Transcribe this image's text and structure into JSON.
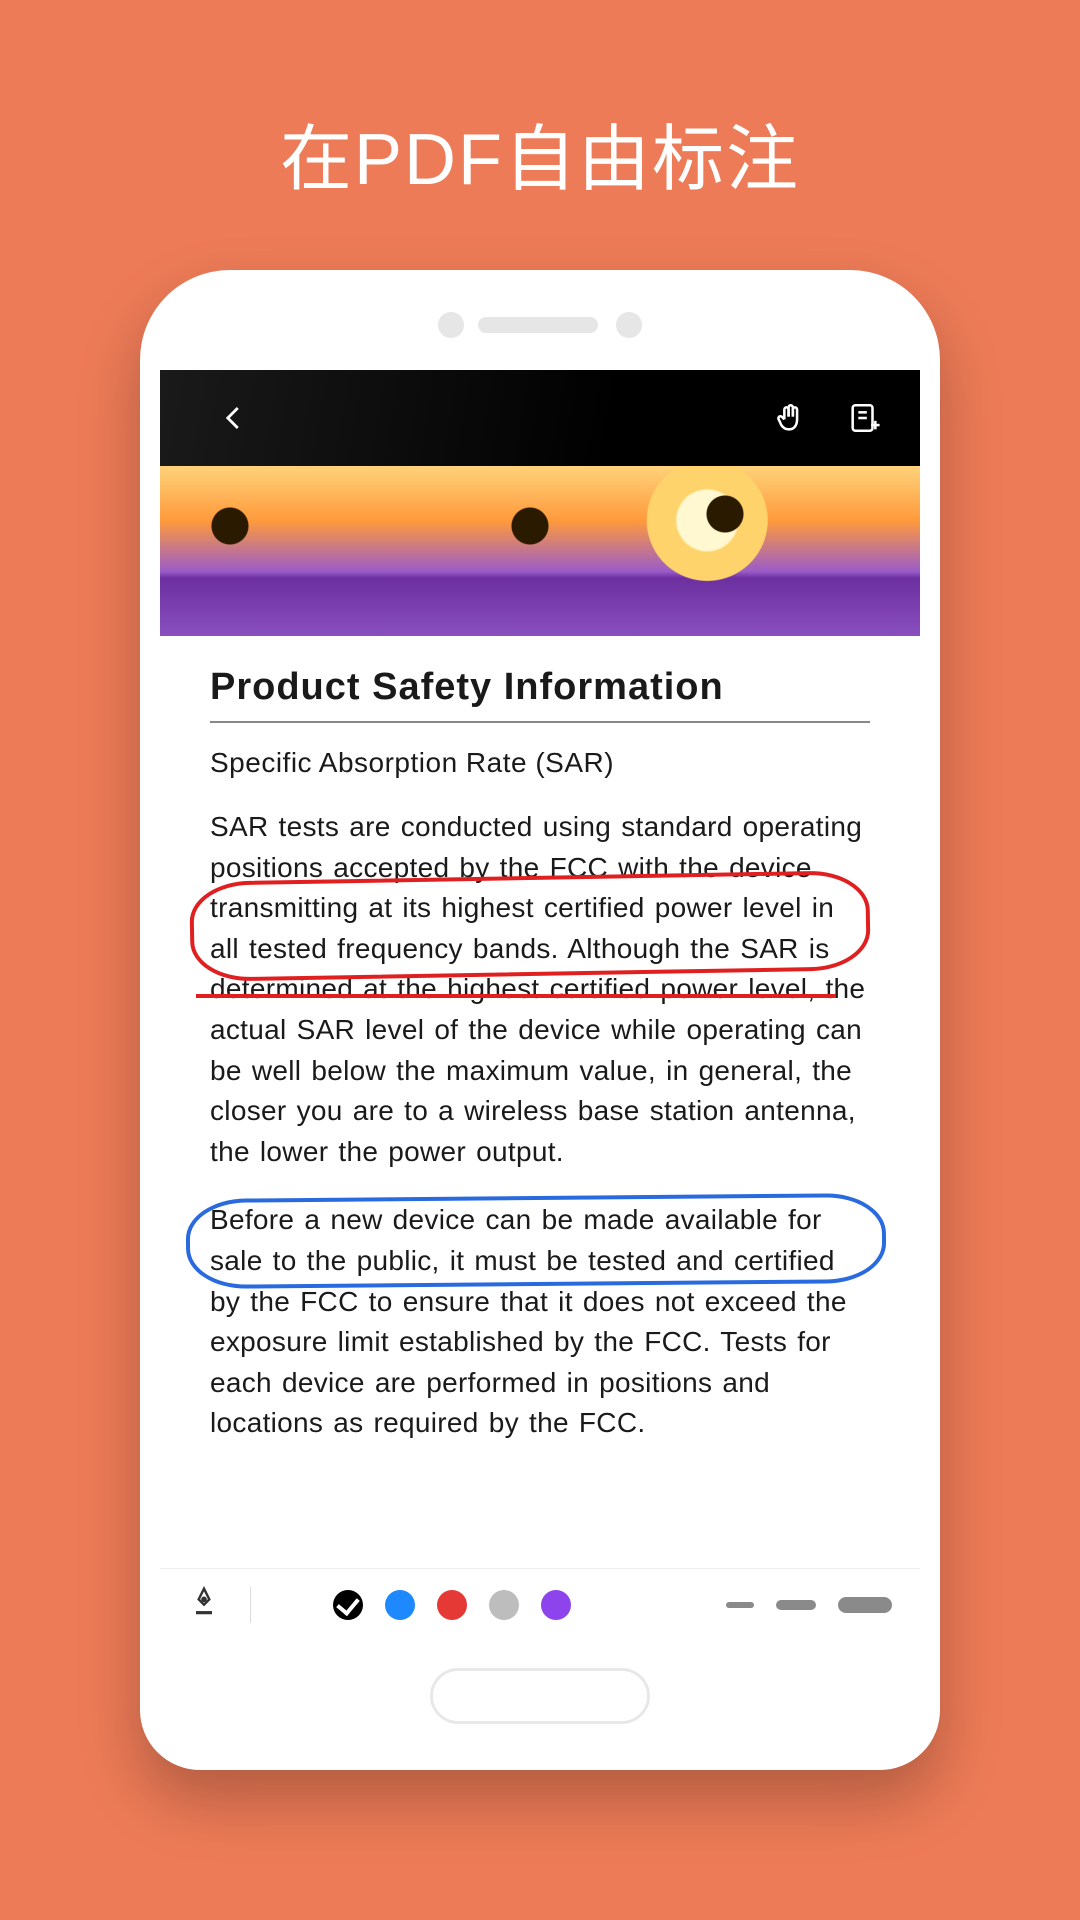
{
  "hero": {
    "title": "在PDF自由标注"
  },
  "topbar": {
    "back_icon": "back-icon",
    "hand_icon": "hand-tool-icon",
    "note_icon": "add-note-icon"
  },
  "document": {
    "title": "Product Safety Information",
    "subtitle": "Specific Absorption Rate (SAR)",
    "para1": "SAR tests are conducted using standard operating positions accepted by the FCC with the device transmitting at its highest certified power level in all tested frequency bands. Although the SAR is determined at the highest certified power level, the actual SAR level of the device while operating can be well below the maximum value, in general, the closer you are to a wireless base station antenna, the lower the power output.",
    "para2": "Before a new device can be made available for sale to the public, it must be tested and certified by the FCC to ensure that it does not exceed the exposure limit established by the FCC. Tests for each device are performed in positions and locations as required by the FCC."
  },
  "annotations": {
    "red_ellipse": "certified power level in all tested frequency bands. Although the SAR is determined at",
    "red_strike": "the highest certified power level, the actual",
    "blue_ellipse": "for sale to the public, it must be tested and certified by the FCC to ensure that it does not"
  },
  "toolbar": {
    "pen_icon": "pen-nib-icon",
    "colors": {
      "black_selected": "#000000",
      "blue": "#1e88ff",
      "red": "#e53935",
      "gray": "#bdbdbd",
      "purple": "#8e44ec"
    },
    "strokes": [
      "thin",
      "medium",
      "thick"
    ]
  }
}
